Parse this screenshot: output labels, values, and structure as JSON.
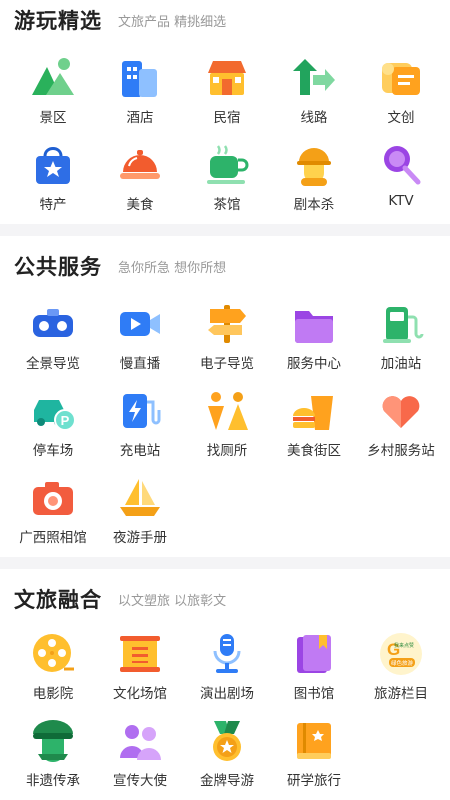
{
  "sections": [
    {
      "title": "游玩精选",
      "subtitle": "文旅产品 精挑细选",
      "items": [
        {
          "label": "景区",
          "icon": "mountain-icon"
        },
        {
          "label": "酒店",
          "icon": "hotel-building-icon"
        },
        {
          "label": "民宿",
          "icon": "guesthouse-icon"
        },
        {
          "label": "线路",
          "icon": "route-arrow-icon"
        },
        {
          "label": "文创",
          "icon": "scroll-icon"
        },
        {
          "label": "特产",
          "icon": "gift-bag-icon"
        },
        {
          "label": "美食",
          "icon": "food-cloche-icon"
        },
        {
          "label": "茶馆",
          "icon": "teacup-icon"
        },
        {
          "label": "剧本杀",
          "icon": "detective-icon"
        },
        {
          "label": "KTV",
          "icon": "microphone-lollipop-icon"
        }
      ]
    },
    {
      "title": "公共服务",
      "subtitle": "急你所急 想你所想",
      "items": [
        {
          "label": "全景导览",
          "icon": "vr-headset-icon"
        },
        {
          "label": "慢直播",
          "icon": "video-camera-icon"
        },
        {
          "label": "电子导览",
          "icon": "signpost-icon"
        },
        {
          "label": "服务中心",
          "icon": "folder-icon"
        },
        {
          "label": "加油站",
          "icon": "fuel-pump-icon"
        },
        {
          "label": "停车场",
          "icon": "parking-car-icon"
        },
        {
          "label": "充电站",
          "icon": "charging-station-icon"
        },
        {
          "label": "找厕所",
          "icon": "restroom-icon"
        },
        {
          "label": "美食街区",
          "icon": "burger-drink-icon"
        },
        {
          "label": "乡村服务站",
          "icon": "heart-icon"
        },
        {
          "label": "广西照相馆",
          "icon": "camera-icon"
        },
        {
          "label": "夜游手册",
          "icon": "sailboat-icon"
        }
      ]
    },
    {
      "title": "文旅融合",
      "subtitle": "以文塑旅 以旅彰文",
      "items": [
        {
          "label": "电影院",
          "icon": "film-reel-icon"
        },
        {
          "label": "文化场馆",
          "icon": "scroll-frame-icon"
        },
        {
          "label": "演出剧场",
          "icon": "stage-mic-icon"
        },
        {
          "label": "图书馆",
          "icon": "books-icon"
        },
        {
          "label": "旅游栏目",
          "icon": "tv-program-logo-icon",
          "logo_text": [
            "我来点赞",
            "绿色旅游"
          ]
        },
        {
          "label": "非遗传承",
          "icon": "heritage-hat-icon"
        },
        {
          "label": "宣传大使",
          "icon": "ambassador-people-icon"
        },
        {
          "label": "金牌导游",
          "icon": "gold-medal-icon"
        },
        {
          "label": "研学旅行",
          "icon": "study-book-icon"
        }
      ]
    }
  ]
}
